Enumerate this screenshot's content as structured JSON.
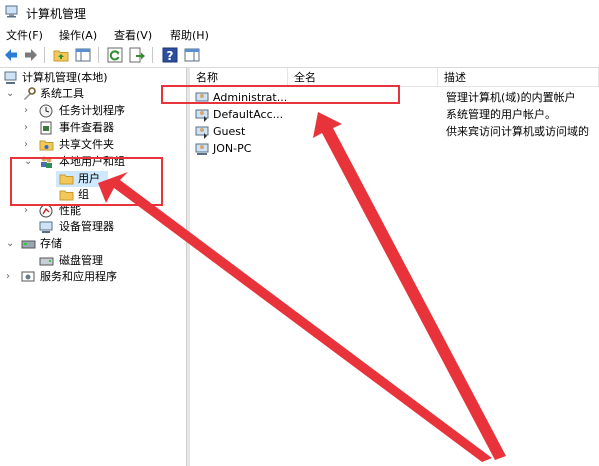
{
  "window": {
    "title": "计算机管理"
  },
  "menu": [
    "文件(F)",
    "操作(A)",
    "查看(V)",
    "帮助(H)"
  ],
  "toolbar": {
    "buttons": [
      "back-icon",
      "forward-icon",
      "folder-up-icon",
      "show-tree-icon",
      "refresh-icon",
      "export-icon",
      "help-icon",
      "properties-icon"
    ]
  },
  "tree": [
    {
      "label": "计算机管理(本地)",
      "icon": "computer-management-icon"
    },
    {
      "label": "系统工具",
      "icon": "tools-icon"
    },
    {
      "label": "任务计划程序",
      "icon": "clock-icon"
    },
    {
      "label": "事件查看器",
      "icon": "event-viewer-icon"
    },
    {
      "label": "共享文件夹",
      "icon": "shared-folder-icon"
    },
    {
      "label": "本地用户和组",
      "icon": "users-group-icon"
    },
    {
      "label": "用户",
      "icon": "folder-icon"
    },
    {
      "label": "组",
      "icon": "folder-icon"
    },
    {
      "label": "性能",
      "icon": "performance-icon"
    },
    {
      "label": "设备管理器",
      "icon": "device-manager-icon"
    },
    {
      "label": "存储",
      "icon": "storage-icon"
    },
    {
      "label": "磁盘管理",
      "icon": "disk-icon"
    },
    {
      "label": "服务和应用程序",
      "icon": "services-icon"
    }
  ],
  "list": {
    "columns": [
      "名称",
      "全名",
      "描述"
    ],
    "rows": [
      {
        "name": "Administrat...",
        "fullname": "",
        "description": "管理计算机(域)的内置帐户"
      },
      {
        "name": "DefaultAcc...",
        "fullname": "",
        "description": "系统管理的用户帐户。"
      },
      {
        "name": "Guest",
        "fullname": "",
        "description": "供来宾访问计算机或访问域的"
      },
      {
        "name": "JON-PC",
        "fullname": "",
        "description": ""
      }
    ]
  },
  "colors": {
    "annotation": "#e8333a",
    "selection": "#cde8ff"
  }
}
